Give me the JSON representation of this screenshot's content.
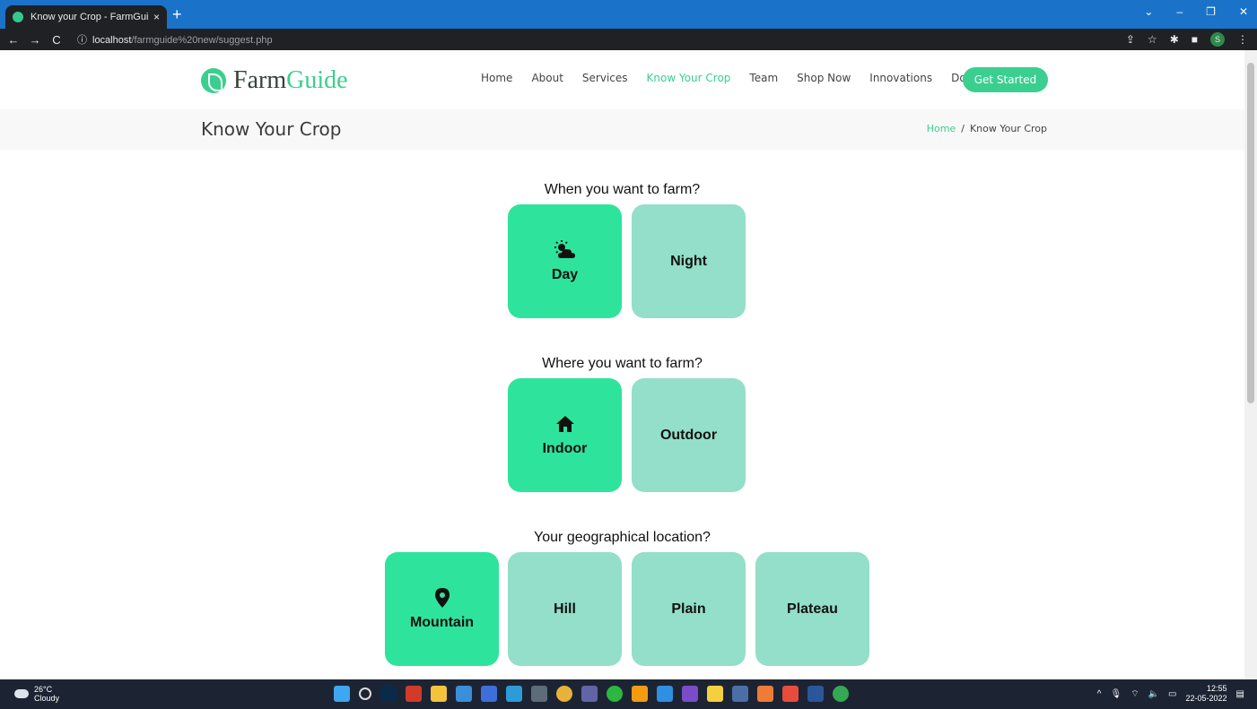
{
  "browser": {
    "tab_title": "Know your Crop - FarmGuide",
    "tab_close": "×",
    "new_tab": "+",
    "url_host": "localhost",
    "url_path": "/farmguide%20new/suggest.php",
    "profile_initial": "S",
    "window_controls": [
      "⌄",
      "–",
      "❐",
      "✕"
    ]
  },
  "site": {
    "logo_text_1": "Farm",
    "logo_text_2": "Guide",
    "nav": [
      "Home",
      "About",
      "Services",
      "Know Your Crop",
      "Team",
      "Shop Now",
      "Innovations",
      "Donate"
    ],
    "active_nav": "Know Your Crop",
    "cta": "Get Started",
    "page_title": "Know Your Crop",
    "breadcrumb": {
      "home": "Home",
      "separator": "/",
      "current": "Know Your Crop"
    },
    "accent_color": "#3acf8e"
  },
  "questions": [
    {
      "text": "When you want to farm?",
      "options": [
        {
          "label": "Day",
          "icon": "cloud-sun-icon",
          "selected": true
        },
        {
          "label": "Night",
          "icon": null,
          "selected": false
        }
      ]
    },
    {
      "text": "Where you want to farm?",
      "options": [
        {
          "label": "Indoor",
          "icon": "home-icon",
          "selected": true
        },
        {
          "label": "Outdoor",
          "icon": null,
          "selected": false
        }
      ]
    },
    {
      "text": "Your geographical location?",
      "options": [
        {
          "label": "Mountain",
          "icon": "map-pin-icon",
          "selected": true
        },
        {
          "label": "Hill",
          "icon": null,
          "selected": false
        },
        {
          "label": "Plain",
          "icon": null,
          "selected": false
        },
        {
          "label": "Plateau",
          "icon": null,
          "selected": false
        }
      ]
    }
  ],
  "colors": {
    "selected": "#2ee49c",
    "unselected": "#93dfc9"
  },
  "taskbar": {
    "temperature": "26°C",
    "weather": "Cloudy",
    "time": "12:55",
    "date": "22-05-2022"
  }
}
